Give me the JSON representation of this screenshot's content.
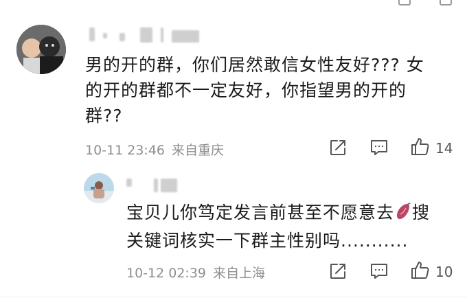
{
  "comments": [
    {
      "text_lines": [
        "男的开的群，你们居然敢信女性友好??? 女",
        "的开的群都不一定友好，你指望男的开的",
        "群??"
      ],
      "time": "10-11 23:46",
      "location": "来自重庆",
      "likes": "14",
      "avatar_icon": "couple-photo-avatar"
    },
    {
      "text_line1": "宝贝儿你笃定发言前甚至不愿意去",
      "text_line1_tail": "搜",
      "text_line2": "关键词核实一下群主性别吗...........",
      "emoji": "sweet-potato-emoji",
      "time": "10-12 02:39",
      "location": "来自上海",
      "likes": "10",
      "avatar_icon": "beach-photo-avatar"
    }
  ],
  "icons": [
    "share-icon",
    "comment-icon",
    "like-icon"
  ],
  "colors": {
    "text": "#1a1a1a",
    "meta": "#8e8e8e",
    "icon": "#555555"
  }
}
